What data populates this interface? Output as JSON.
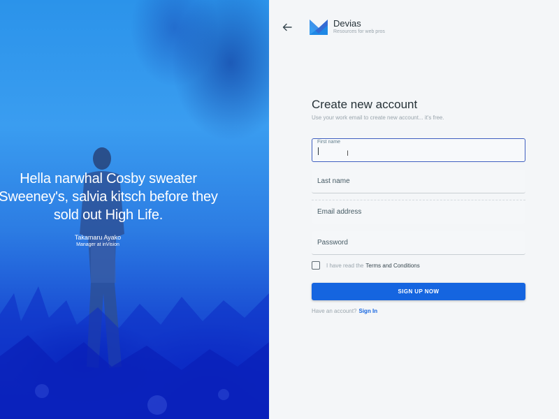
{
  "hero": {
    "quote": "Hella narwhal Cosby sweater Sweeney's, salvia kitsch before they sold out High Life.",
    "author_name": "Takamaru Ayako",
    "author_role": "Manager at inVision"
  },
  "brand": {
    "name": "Devias",
    "tagline": "Resources for web pros"
  },
  "form": {
    "title": "Create new account",
    "subtitle": "Use your work email to create new account... it's free.",
    "first_name_label": "First name",
    "first_name_value": "",
    "last_name_label": "Last name",
    "email_label": "Email address",
    "password_label": "Password",
    "terms_prefix": "I have read the",
    "terms_link": "Terms and Conditions",
    "terms_checked": false,
    "submit_label": "SIGN UP NOW",
    "have_account": "Have an account?",
    "sign_in": "Sign In"
  },
  "icons": {
    "back": "arrow-left-icon",
    "logo": "devias-logo-icon",
    "cursor": "text-cursor-icon"
  },
  "colors": {
    "primary": "#1565e0",
    "focus_border": "#3f5fbf",
    "hero_top": "#2b93ea",
    "hero_bottom": "#0b22c4",
    "panel_bg": "#f4f6f8"
  }
}
